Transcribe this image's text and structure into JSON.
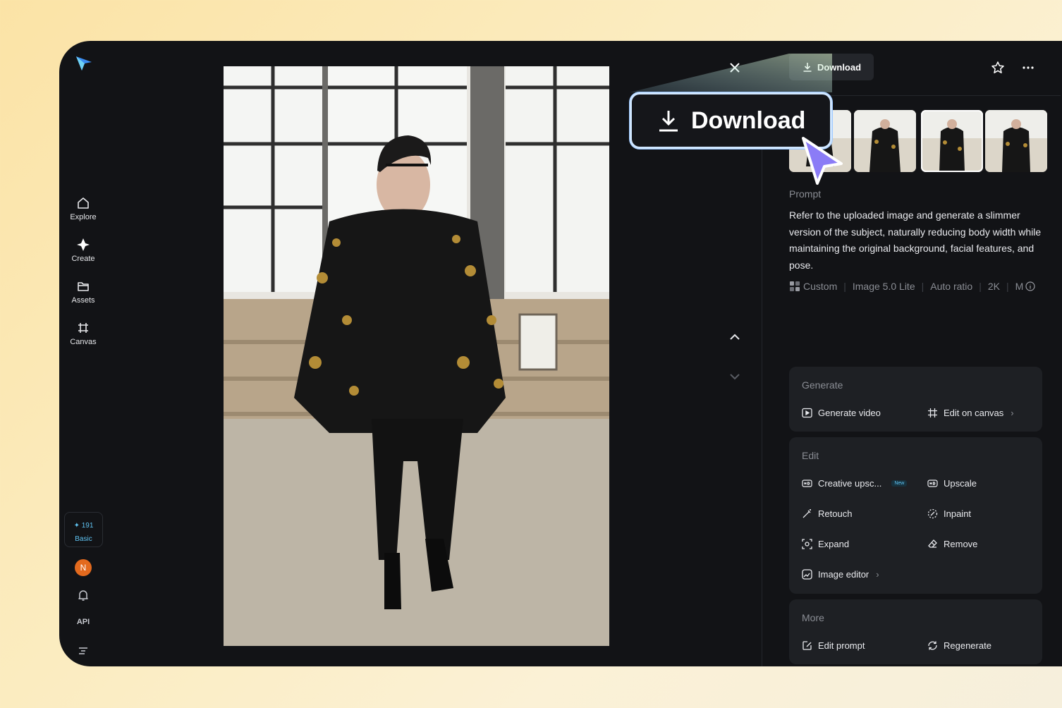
{
  "nav": {
    "items": [
      {
        "label": "Explore",
        "icon": "home-icon"
      },
      {
        "label": "Create",
        "icon": "sparkle-icon"
      },
      {
        "label": "Assets",
        "icon": "folder-icon"
      },
      {
        "label": "Canvas",
        "icon": "canvas-icon"
      }
    ],
    "credits_value": "191",
    "credits_plan": "Basic",
    "avatar_initial": "N",
    "api_label": "API"
  },
  "header": {
    "download_label": "Download"
  },
  "callout": {
    "download_label": "Download"
  },
  "prompt": {
    "label": "Prompt",
    "text": "Refer to the uploaded image and generate a slimmer version of the subject, naturally reducing body width while maintaining the original background, facial features, and pose."
  },
  "meta": {
    "style": "Custom",
    "model": "Image 5.0 Lite",
    "ratio": "Auto ratio",
    "resolution": "2K",
    "more": "M"
  },
  "generate": {
    "title": "Generate",
    "video": "Generate video",
    "canvas": "Edit on canvas"
  },
  "edit": {
    "title": "Edit",
    "creative_upscale": "Creative upsc...",
    "new_badge": "New",
    "upscale": "Upscale",
    "retouch": "Retouch",
    "inpaint": "Inpaint",
    "expand": "Expand",
    "remove": "Remove",
    "image_editor": "Image editor"
  },
  "more": {
    "title": "More",
    "edit_prompt": "Edit prompt",
    "regenerate": "Regenerate"
  },
  "colors": {
    "accent": "#5fc3f2",
    "panel": "#1e2024",
    "background": "#121316",
    "cursor": "#8b7cf6"
  }
}
